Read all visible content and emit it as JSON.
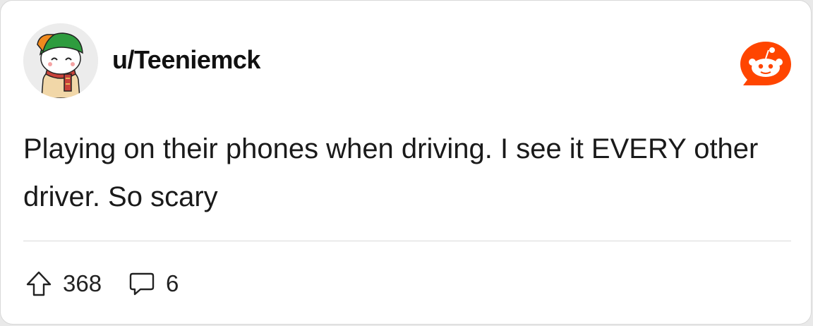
{
  "post": {
    "username": "u/Teeniemck",
    "body": "Playing on their phones when driving. I see it EVERY other driver. So scary",
    "upvotes": "368",
    "comments": "6"
  },
  "icons": {
    "avatar": "snoo-avatar-green-hat-scarf",
    "brand": "reddit-logo",
    "upvote": "upvote-arrow-icon",
    "comment": "comment-bubble-icon"
  },
  "colors": {
    "brand": "#ff4500",
    "text": "#1a1a1a",
    "background": "#ffffff"
  }
}
